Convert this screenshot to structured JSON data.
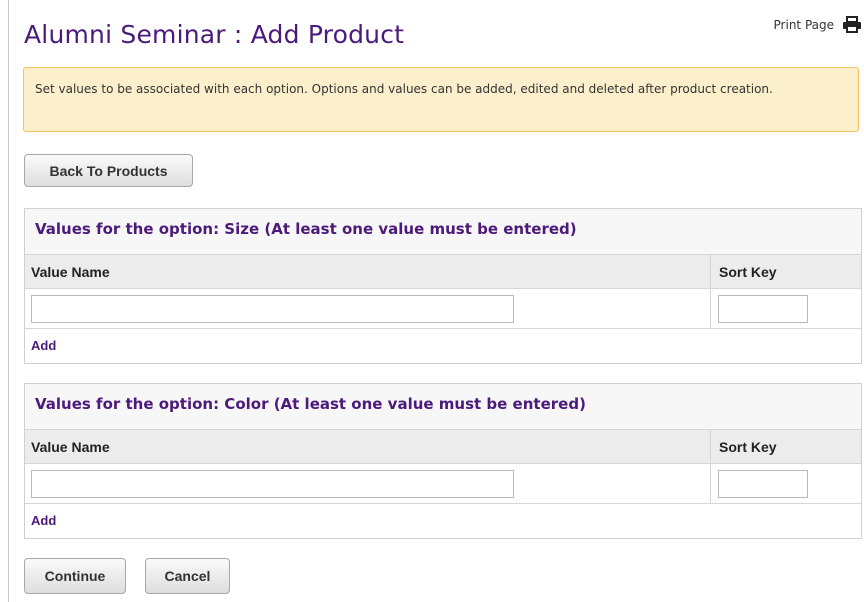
{
  "header": {
    "title": "Alumni Seminar : Add Product",
    "print_label": "Print Page"
  },
  "alert": {
    "text": "Set values to be associated with each option. Options and values can be added, edited and deleted after product creation."
  },
  "buttons": {
    "back": "Back To Products",
    "continue": "Continue",
    "cancel": "Cancel"
  },
  "options": [
    {
      "title": "Values for the option: Size (At least one value must be entered)",
      "col_value_name": "Value Name",
      "col_sort_key": "Sort Key",
      "value_name": "",
      "sort_key": "",
      "add_label": "Add"
    },
    {
      "title": "Values for the option: Color (At least one value must be entered)",
      "col_value_name": "Value Name",
      "col_sort_key": "Sort Key",
      "value_name": "",
      "sort_key": "",
      "add_label": "Add"
    }
  ],
  "icons": {
    "print": "printer-icon"
  },
  "colors": {
    "accent": "#4b1a7a",
    "alert_bg": "#fcf0cc",
    "alert_border": "#f0c45a"
  }
}
